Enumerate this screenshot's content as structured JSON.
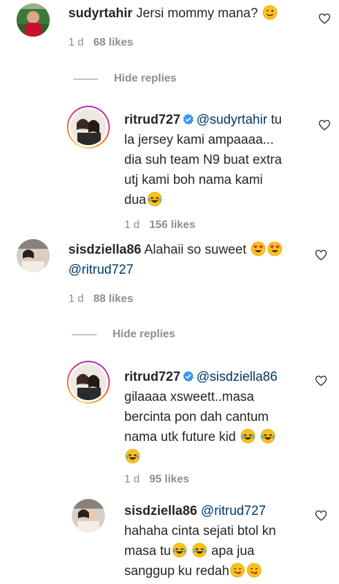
{
  "comments": [
    {
      "username": "sudyrtahir",
      "text": "Jersi mommy mana?",
      "emoji": "wink-emoji",
      "time": "1 d",
      "likes": "68 likes",
      "hide_replies": "Hide replies"
    },
    {
      "username": "ritrud727",
      "mention": "@sudyrtahir",
      "line1_tail": "tu",
      "lines": [
        "la jersey kami ampaaaa...",
        "dia suh team N9 buat extra",
        "utj kami boh nama kami",
        "dua"
      ],
      "time": "1 d",
      "likes": "156 likes"
    },
    {
      "username": "sisdziella86",
      "text": "Alahaii so suweet",
      "mention": "@ritrud727",
      "time": "1 d",
      "likes": "88 likes",
      "hide_replies": "Hide replies"
    },
    {
      "username": "ritrud727",
      "mention": "@sisdziella86",
      "lines": [
        "gilaaaa xsweett..masa",
        "bercinta pon dah cantum",
        "nama utk future kid"
      ],
      "time": "1 d",
      "likes": "95 likes"
    },
    {
      "username": "sisdziella86",
      "mention": "@ritrud727",
      "lines": [
        "hahaha cinta sejati btol kn",
        "masa tu",
        "apa jua",
        "sanggup ku redah"
      ]
    }
  ],
  "colors": {
    "text": "#262626",
    "meta": "#8e8e8e",
    "mention": "#00376b",
    "verified": "#3897f0"
  }
}
